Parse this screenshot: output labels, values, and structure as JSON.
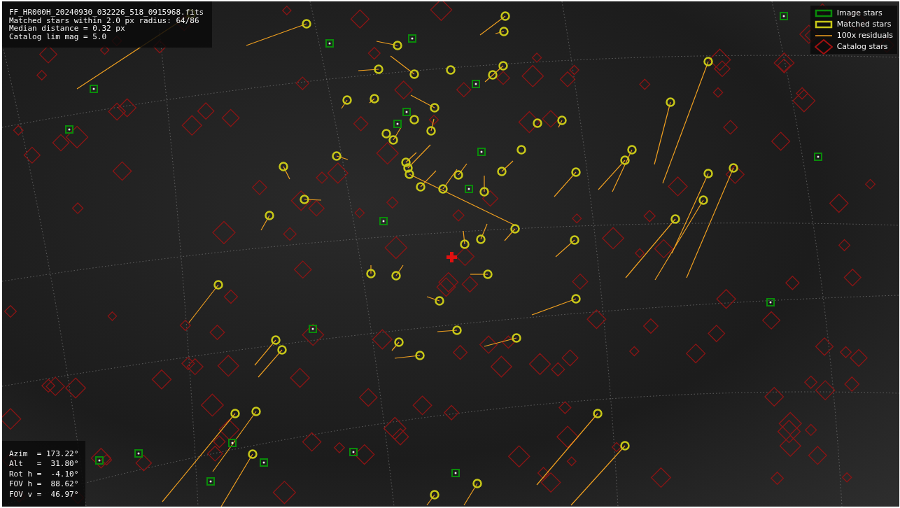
{
  "info_box": {
    "lines": [
      "FF_HR000H_20240930_032226_518_0915968.fits",
      "Matched stars within 2.0 px radius: 64/86",
      "Median distance = 0.32 px",
      "Catalog lim mag = 5.0"
    ]
  },
  "legend": [
    {
      "kind": "image_star",
      "label": "Image stars"
    },
    {
      "kind": "matched_star",
      "label": "Matched stars"
    },
    {
      "kind": "residual",
      "label": "100x residuals"
    },
    {
      "kind": "catalog_star",
      "label": "Catalog stars"
    }
  ],
  "pointing_box": {
    "lines": [
      "Azim  = 173.22°",
      "Alt   =  31.80°",
      "Rot h =  -4.10°",
      "FOV h =  88.62°",
      "FOV v =  46.97°"
    ]
  }
}
